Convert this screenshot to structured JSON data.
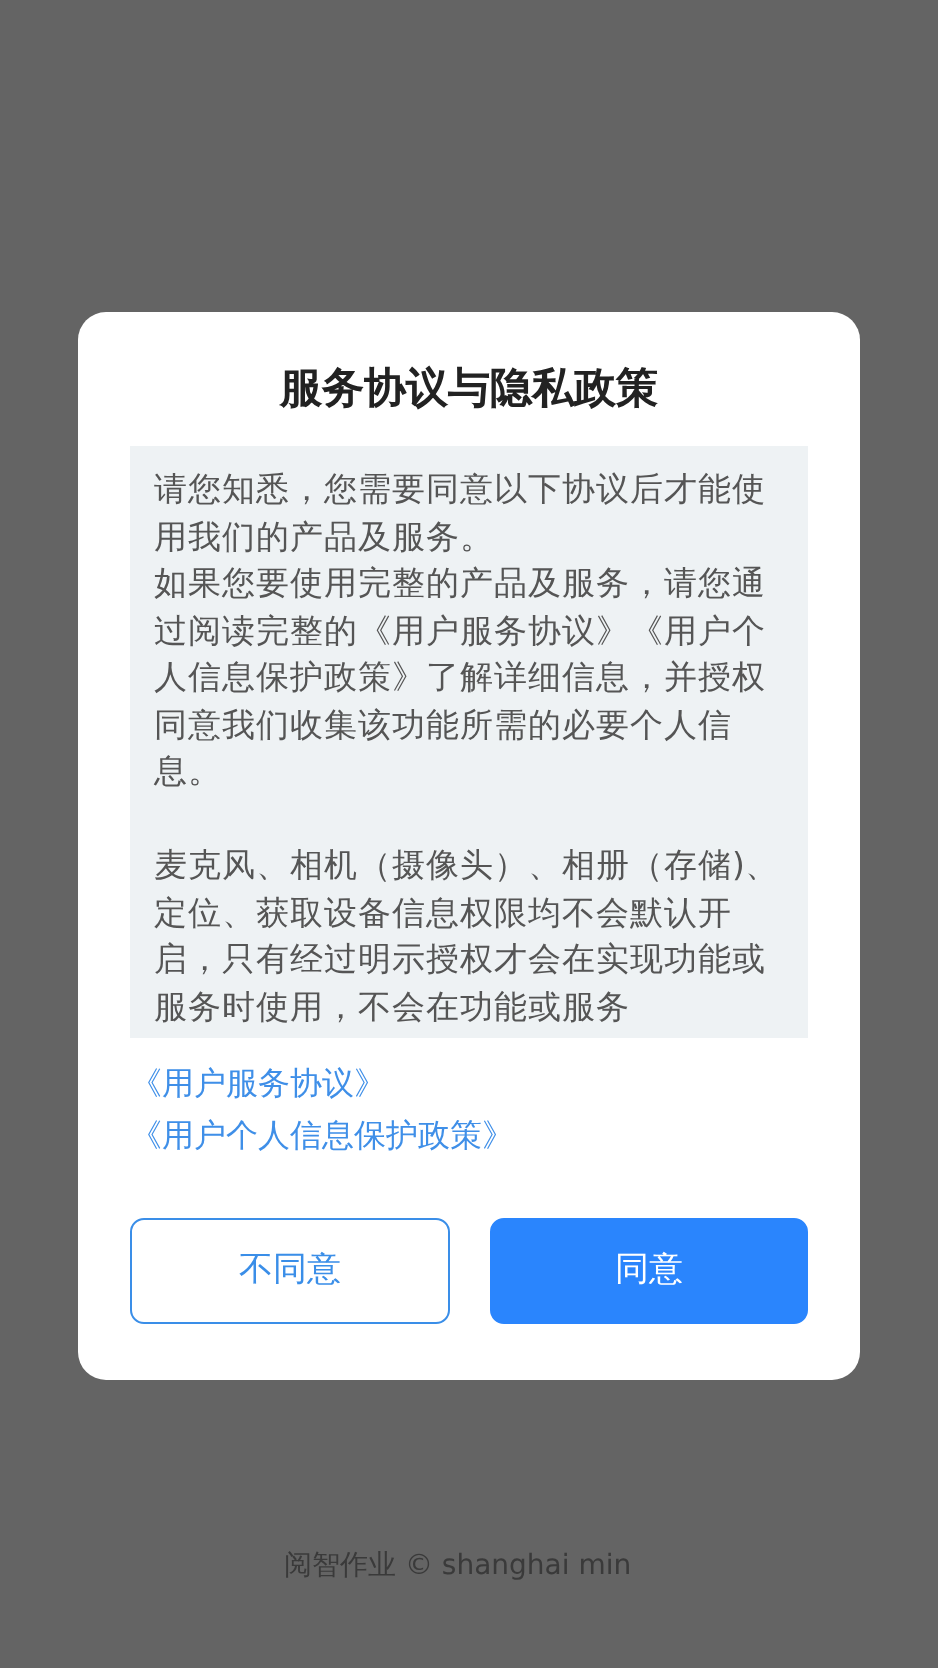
{
  "dialog": {
    "title": "服务协议与隐私政策",
    "notice": {
      "sections": [
        [
          "请您知悉，您需要同意以下协议后才能使用我们的产品及服务。",
          "如果您要使用完整的产品及服务，请您通过阅读完整的《用户服务协议》《用户个人信息保护政策》了解详细信息，并授权同意我们收集该功能所需的必要个人信息。"
        ],
        [
          "麦克风、相机（摄像头）、相册（存储)、定位、获取设备信息权限均不会默认开启，只有经过明示授权才会在实现功能或服务时使用，不会在功能或服务"
        ]
      ]
    },
    "links": [
      "《用户服务协议》",
      "《用户个人信息保护政策》"
    ],
    "buttons": [
      {
        "label": "不同意",
        "kind": "outline"
      },
      {
        "label": "同意",
        "kind": "primary"
      }
    ]
  },
  "footer": "阅智作业 © shanghai min"
}
